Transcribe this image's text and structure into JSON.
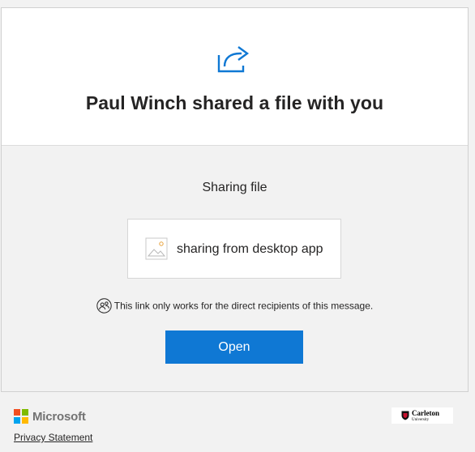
{
  "header": {
    "icon": "share-arrow-icon",
    "title": "Paul Winch shared a file with you"
  },
  "content": {
    "sharing_label": "Sharing file",
    "file": {
      "icon": "image-file-icon",
      "name": "sharing from desktop app"
    },
    "notice": {
      "icon": "recipients-icon",
      "text": "This link only works for the direct recipients of this message."
    },
    "open_button_label": "Open"
  },
  "footer": {
    "brand": "Microsoft",
    "privacy_link": "Privacy Statement",
    "org_logo": {
      "line1": "Carleton",
      "line2": "University"
    }
  },
  "colors": {
    "accent": "#0f78d4",
    "page_bg": "#f2f2f2",
    "card_top_bg": "#ffffff",
    "ms_red": "#f25022",
    "ms_green": "#7fba00",
    "ms_blue": "#00a4ef",
    "ms_yellow": "#ffb900",
    "org_red": "#c8102e"
  }
}
